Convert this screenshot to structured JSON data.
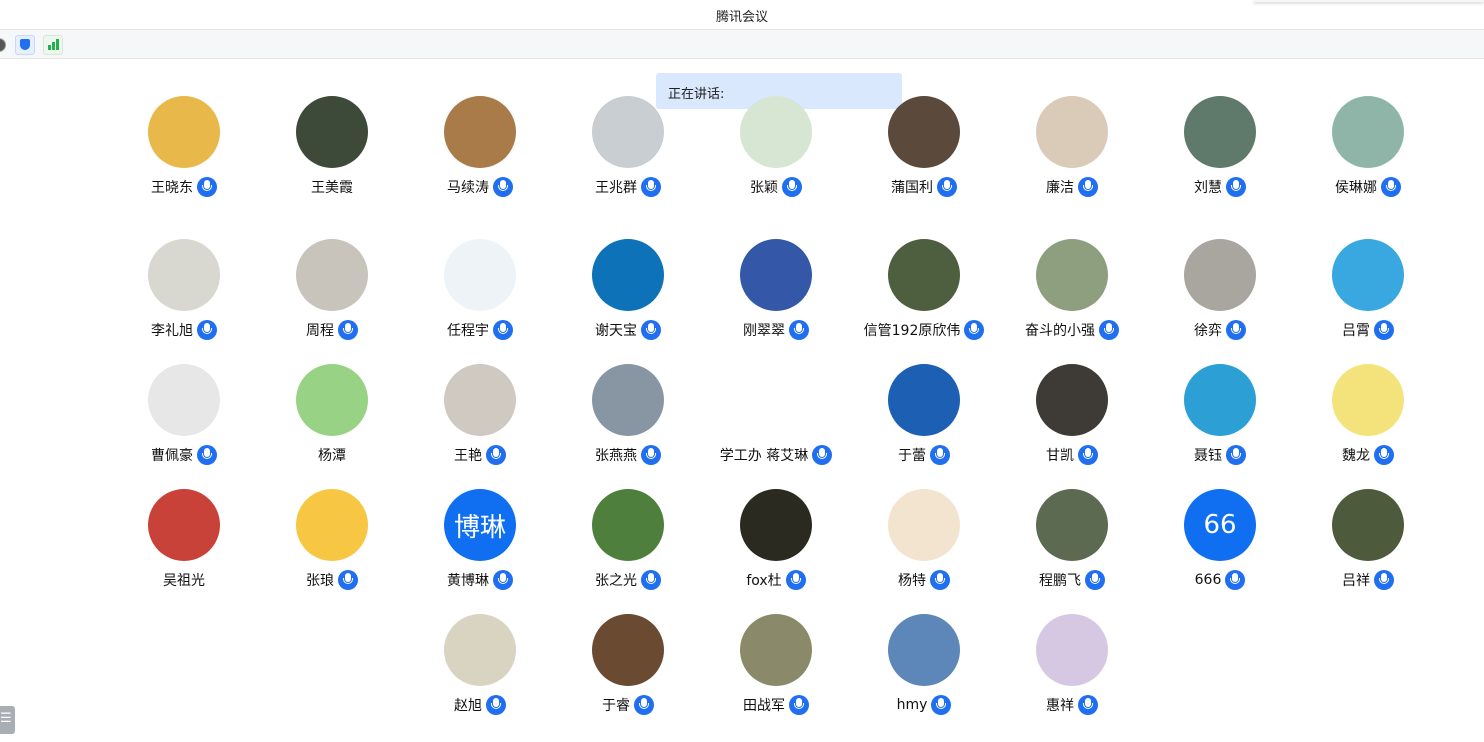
{
  "window": {
    "title": "腾讯会议"
  },
  "toolbar": {
    "icons": [
      "record-icon",
      "security-shield-icon",
      "network-signal-icon"
    ]
  },
  "speaking": {
    "label": "正在讲话:"
  },
  "colors": {
    "accent": "#1f6ff0",
    "speaking_bg": "#d9e8fd"
  },
  "participants": [
    {
      "name": "王晓东",
      "avatar": "horse-cartoon",
      "bg": "#e9b84a",
      "mic": true
    },
    {
      "name": "王美霞",
      "avatar": "park-photo",
      "bg": "#3d4a3a",
      "mic": false
    },
    {
      "name": "马续涛",
      "avatar": "kids-playing",
      "bg": "#a87b48",
      "mic": true
    },
    {
      "name": "王兆群",
      "avatar": "figurine",
      "bg": "#c9ced3",
      "mic": true
    },
    {
      "name": "张颖",
      "avatar": "plants-illustration",
      "bg": "#d7e6d2",
      "mic": true
    },
    {
      "name": "蒲国利",
      "avatar": "bonfire",
      "bg": "#5b4a3c",
      "mic": true
    },
    {
      "name": "廉洁",
      "avatar": "cup-photo",
      "bg": "#d9cbb8",
      "mic": true
    },
    {
      "name": "刘慧",
      "avatar": "lake-trees",
      "bg": "#5f7a6a",
      "mic": true
    },
    {
      "name": "侯琳娜",
      "avatar": "mural-child",
      "bg": "#8fb5a8",
      "mic": true
    },
    {
      "name": "李礼旭",
      "avatar": "ink-portrait",
      "bg": "#d8d8d0",
      "mic": true
    },
    {
      "name": "周程",
      "avatar": "penguins",
      "bg": "#c8c4bc",
      "mic": true
    },
    {
      "name": "任程宇",
      "avatar": "goose-cartoon",
      "bg": "#eef3f8",
      "mic": true
    },
    {
      "name": "谢天宝",
      "avatar": "happy-smile",
      "bg": "#0d72b8",
      "mic": true
    },
    {
      "name": "刚翠翠",
      "avatar": "man-bubbles",
      "bg": "#3457a8",
      "mic": true
    },
    {
      "name": "信管192原欣伟",
      "avatar": "forest-people",
      "bg": "#4d5f3e",
      "mic": true
    },
    {
      "name": "奋斗的小强",
      "avatar": "monkey-cartoon",
      "bg": "#8e9f80",
      "mic": true
    },
    {
      "name": "徐弈",
      "avatar": "stone-ground",
      "bg": "#a9a59f",
      "mic": true
    },
    {
      "name": "吕霄",
      "avatar": "water-pool",
      "bg": "#39a7e0",
      "mic": true
    },
    {
      "name": "曹佩豪",
      "avatar": "boy-photo",
      "bg": "#e7e7e7",
      "mic": true
    },
    {
      "name": "杨潭",
      "avatar": "green-cards",
      "bg": "#98d385",
      "mic": false
    },
    {
      "name": "王艳",
      "avatar": "panda-mascot",
      "bg": "#cfc9c2",
      "mic": true
    },
    {
      "name": "张燕燕",
      "avatar": "woman-lake",
      "bg": "#8896a4",
      "mic": true
    },
    {
      "name": "学工办 蒋艾琳",
      "avatar": "line-art-girl",
      "bg": "#ffffff",
      "mic": true
    },
    {
      "name": "于蕾",
      "avatar": "eagle-sky",
      "bg": "#1d5fb3",
      "mic": true
    },
    {
      "name": "甘凯",
      "avatar": "sign-board",
      "bg": "#3e3a36",
      "mic": true
    },
    {
      "name": "聂钰",
      "avatar": "green-leaves",
      "bg": "#2c9fd4",
      "mic": true
    },
    {
      "name": "魏龙",
      "avatar": "sunglasses-cartoon",
      "bg": "#f4e27a",
      "mic": true
    },
    {
      "name": "吴祖光",
      "avatar": "tower-festival",
      "bg": "#c9423a",
      "mic": false
    },
    {
      "name": "张琅",
      "avatar": "good-mood-cat",
      "bg": "#f7c744",
      "mic": true
    },
    {
      "name": "黄博琳",
      "avatar": "text-avatar",
      "avatar_text": "博琳",
      "bg": "#0f6ff0",
      "mic": true
    },
    {
      "name": "张之光",
      "avatar": "lotus-field",
      "bg": "#4e7f3c",
      "mic": true
    },
    {
      "name": "fox杜",
      "avatar": "night-walk",
      "bg": "#2a2a20",
      "mic": true
    },
    {
      "name": "杨特",
      "avatar": "panda-tea",
      "bg": "#f3e4cf",
      "mic": true
    },
    {
      "name": "程鹏飞",
      "avatar": "tree-frame",
      "bg": "#5d6a52",
      "mic": true
    },
    {
      "name": "666",
      "avatar": "text-avatar",
      "avatar_text": "66",
      "bg": "#0f6ff0",
      "mic": true
    },
    {
      "name": "吕祥",
      "avatar": "dandelion",
      "bg": "#4e5a3c",
      "mic": true
    },
    {
      "name": "赵旭",
      "avatar": "painting-people",
      "bg": "#d9d3c2",
      "mic": true
    },
    {
      "name": "于睿",
      "avatar": "bridge-stream",
      "bg": "#6b4a32",
      "mic": true
    },
    {
      "name": "田战军",
      "avatar": "man-field",
      "bg": "#8a8a6a",
      "mic": true
    },
    {
      "name": "hmy",
      "avatar": "palm-beach",
      "bg": "#5c87b8",
      "mic": true
    },
    {
      "name": "惠祥",
      "avatar": "lilac-cartoon",
      "bg": "#d6c8e2",
      "mic": true
    }
  ]
}
